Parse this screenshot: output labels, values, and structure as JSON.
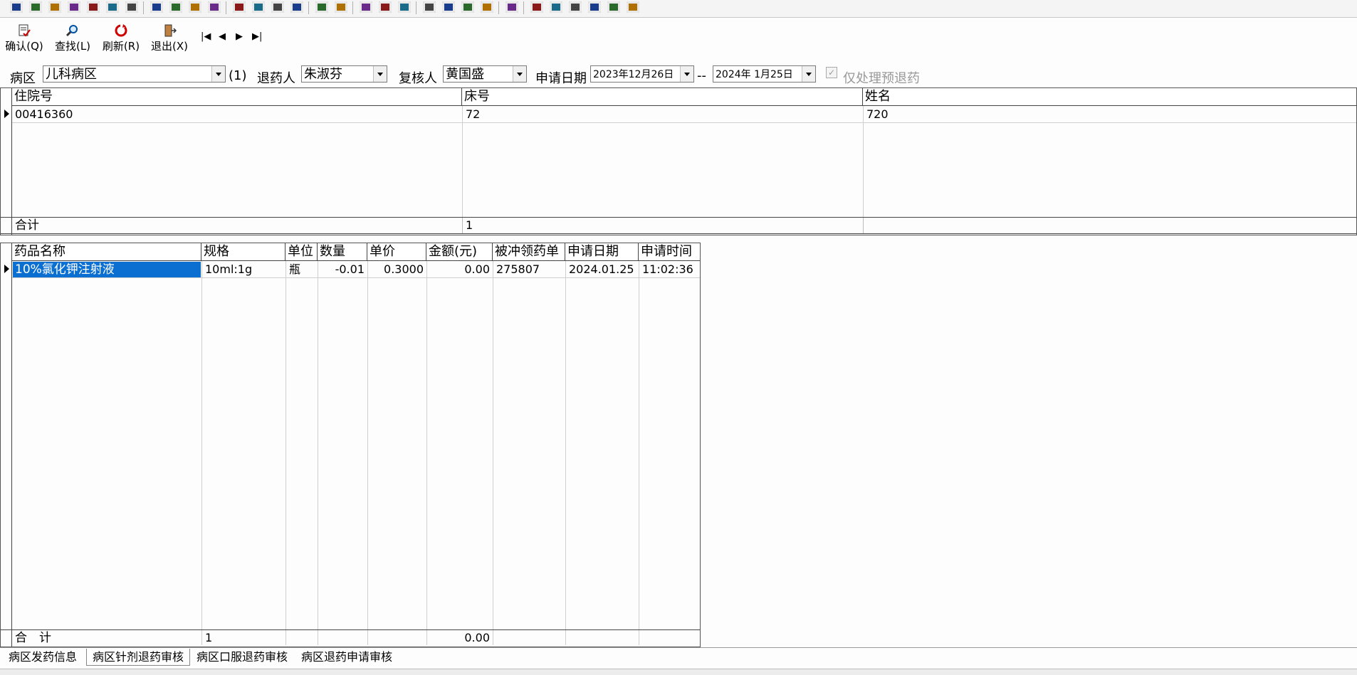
{
  "toolbar": {
    "icons": [
      "print-icon",
      "lock-icon",
      "check-icon",
      "calc-icon",
      "binoculars-icon",
      "grid-check-icon",
      "doc-search-icon",
      "window-icon",
      "doc-edit-icon",
      "checkbox-icon",
      "doc-export-icon",
      "doc-ok-icon",
      "form-icon",
      "table-icon",
      "grid-icon",
      "bell-icon",
      "chart-icon",
      "trash-icon",
      "transfer-icon",
      "lock-transfer-icon",
      "folder-icon",
      "thermometer-icon",
      "magnifier-icon",
      "image-icon",
      "open-icon",
      "circle-icon",
      "zoom-icon",
      "rows-icon",
      "windows-icon",
      "approve-icon",
      "clipboard-icon"
    ]
  },
  "actions": {
    "confirm": "确认(Q)",
    "find": "查找(L)",
    "refresh": "刷新(R)",
    "exit": "退出(X)",
    "nav_first": "|◀",
    "nav_prev": "◀",
    "nav_next": "▶",
    "nav_last": "▶|"
  },
  "filters": {
    "ward_label": "病区",
    "ward_value": "儿科病区",
    "count": "(1)",
    "returner_label": "退药人",
    "returner_value": "朱淑芬",
    "reviewer_label": "复核人",
    "reviewer_value": "黄国盛",
    "date_label": "申请日期",
    "date_from": "2023年12月26日",
    "date_sep": "--",
    "date_to": "2024年  1月25日",
    "pre_return_label": "仅处理预退药"
  },
  "patients": {
    "headers": [
      "住院号",
      "床号",
      "姓名"
    ],
    "rows": [
      [
        "00416360",
        "72",
        "720"
      ]
    ],
    "total_label": "合计",
    "total_values": [
      "",
      "1",
      ""
    ]
  },
  "drugs": {
    "headers": [
      "药品名称",
      "规格",
      "单位",
      "数量",
      "单价",
      "金额(元)",
      "被冲领药单",
      "申请日期",
      "申请时间"
    ],
    "rows": [
      [
        "10%氯化钾注射液",
        "10ml:1g",
        "瓶",
        "-0.01",
        "0.3000",
        "0.00",
        "275807",
        "2024.01.25",
        "11:02:36"
      ]
    ],
    "total_label": "合　计",
    "total_count": "1",
    "total_amount": "0.00"
  },
  "tabs": [
    "病区发药信息",
    "病区针剂退药审核",
    "病区口服退药审核",
    "病区退药申请审核"
  ],
  "active_tab": 1,
  "colors": {
    "selection": "#0a6fd0"
  }
}
